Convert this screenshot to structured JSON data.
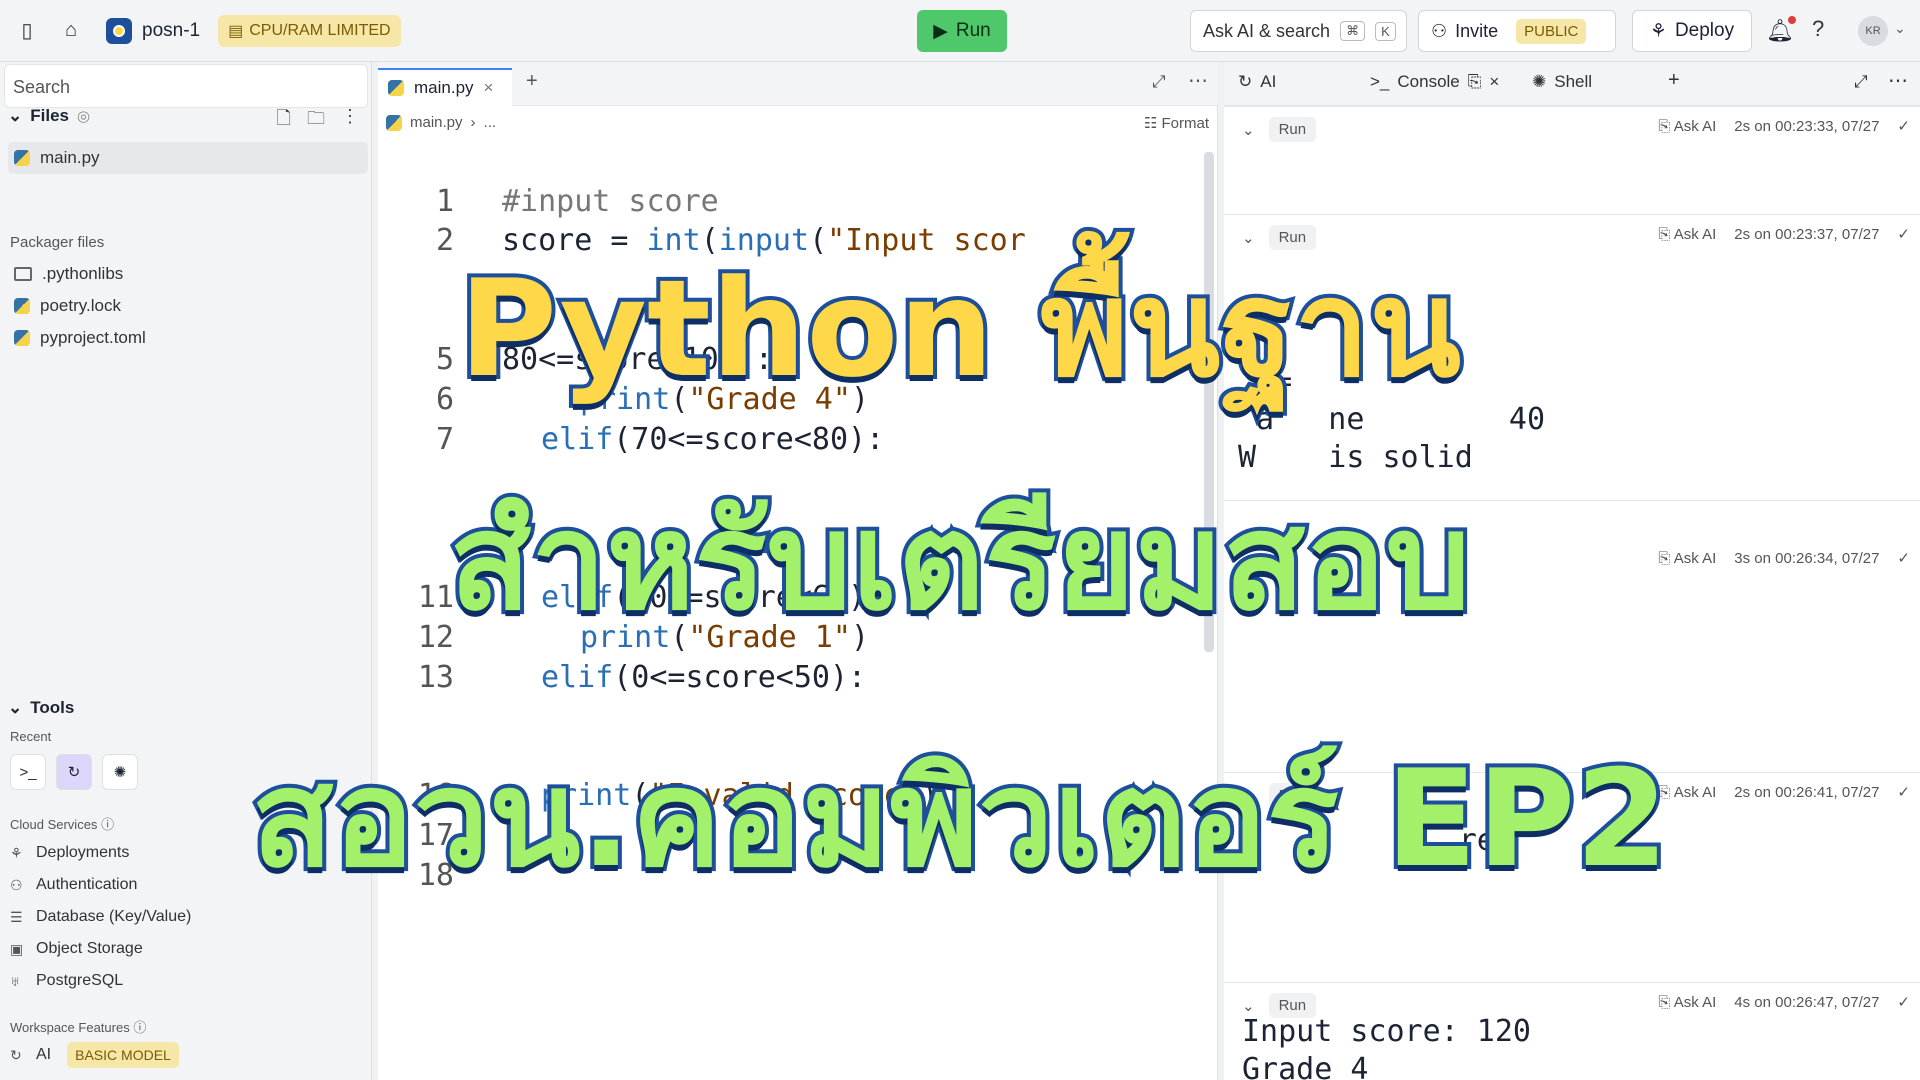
{
  "topbar": {
    "repl_name": "posn-1",
    "limit_badge": "CPU/RAM LIMITED",
    "run_label": "Run",
    "ask_label": "Ask AI & search",
    "kbd_cmd": "⌘",
    "kbd_k": "K",
    "invite_label": "Invite",
    "public_label": "PUBLIC",
    "deploy_label": "Deploy",
    "avatar_initials": "KR"
  },
  "sidebar": {
    "search_placeholder": "Search",
    "files_label": "Files",
    "files": [
      "main.py"
    ],
    "packager_label": "Packager files",
    "packager": [
      ".pythonlibs",
      "poetry.lock",
      "pyproject.toml"
    ],
    "tools_label": "Tools",
    "recent_label": "Recent",
    "cloud_label": "Cloud Services",
    "cloud": [
      "Deployments",
      "Authentication",
      "Database (Key/Value)",
      "Object Storage",
      "PostgreSQL"
    ],
    "workspace_label": "Workspace Features",
    "ai_label": "AI",
    "basic_model": "BASIC MODEL"
  },
  "editor": {
    "tab_name": "main.py",
    "breadcrumb_file": "main.py",
    "breadcrumb_more": "...",
    "format_label": "Format",
    "line_numbers": [
      "1",
      "2",
      "5",
      "6",
      "7",
      "11",
      "12",
      "13",
      "16",
      "17",
      "18"
    ],
    "lines": {
      "l1": "#input score",
      "l2a": "score = ",
      "l2b": "int",
      "l2c": "(",
      "l2d": "input",
      "l2e": "(",
      "l2f": "\"Input scor",
      "l5": "80<=score<100):",
      "l6a": "print",
      "l6b": "(",
      "l6c": "\"Grade 4\"",
      "l6d": ")",
      "l7a": "elif",
      "l7b": "(70<=score<80):",
      "l11a": "elif",
      "l11b": "(50<=score<60):",
      "l12a": "print",
      "l12b": "(",
      "l12c": "\"Grade 1\"",
      "l12d": ")",
      "l13a": "elif",
      "l13b": "(0<=score<50):",
      "l16a": "print",
      "l16b": "(",
      "l16c": "\"Invalid score\"",
      "l16d": ")"
    }
  },
  "console": {
    "ai_tab": "AI",
    "console_tab": "Console",
    "shell_tab": "Shell",
    "run_label": "Run",
    "ask_ai_label": "Ask AI",
    "entries": [
      {
        "time": "2s on 00:23:33, 07/27",
        "output": ""
      },
      {
        "time": "2s on 00:23:37, 07/27",
        "output": "2\n  =\n a   ne        40\nW    is solid"
      },
      {
        "time": "3s on 00:26:34, 07/27",
        "output": ""
      },
      {
        "time": "2s on 00:26:41, 07/27",
        "output": "    t       re:"
      },
      {
        "time": "4s on 00:26:47, 07/27",
        "output": "Input score: 120\nGrade 4"
      }
    ]
  },
  "overlay": {
    "line1": "Python พื้นฐาน",
    "line2": "สำหรับเตรียมสอบ",
    "line3": "สอวน.คอมพิวเตอร์ EP2"
  }
}
